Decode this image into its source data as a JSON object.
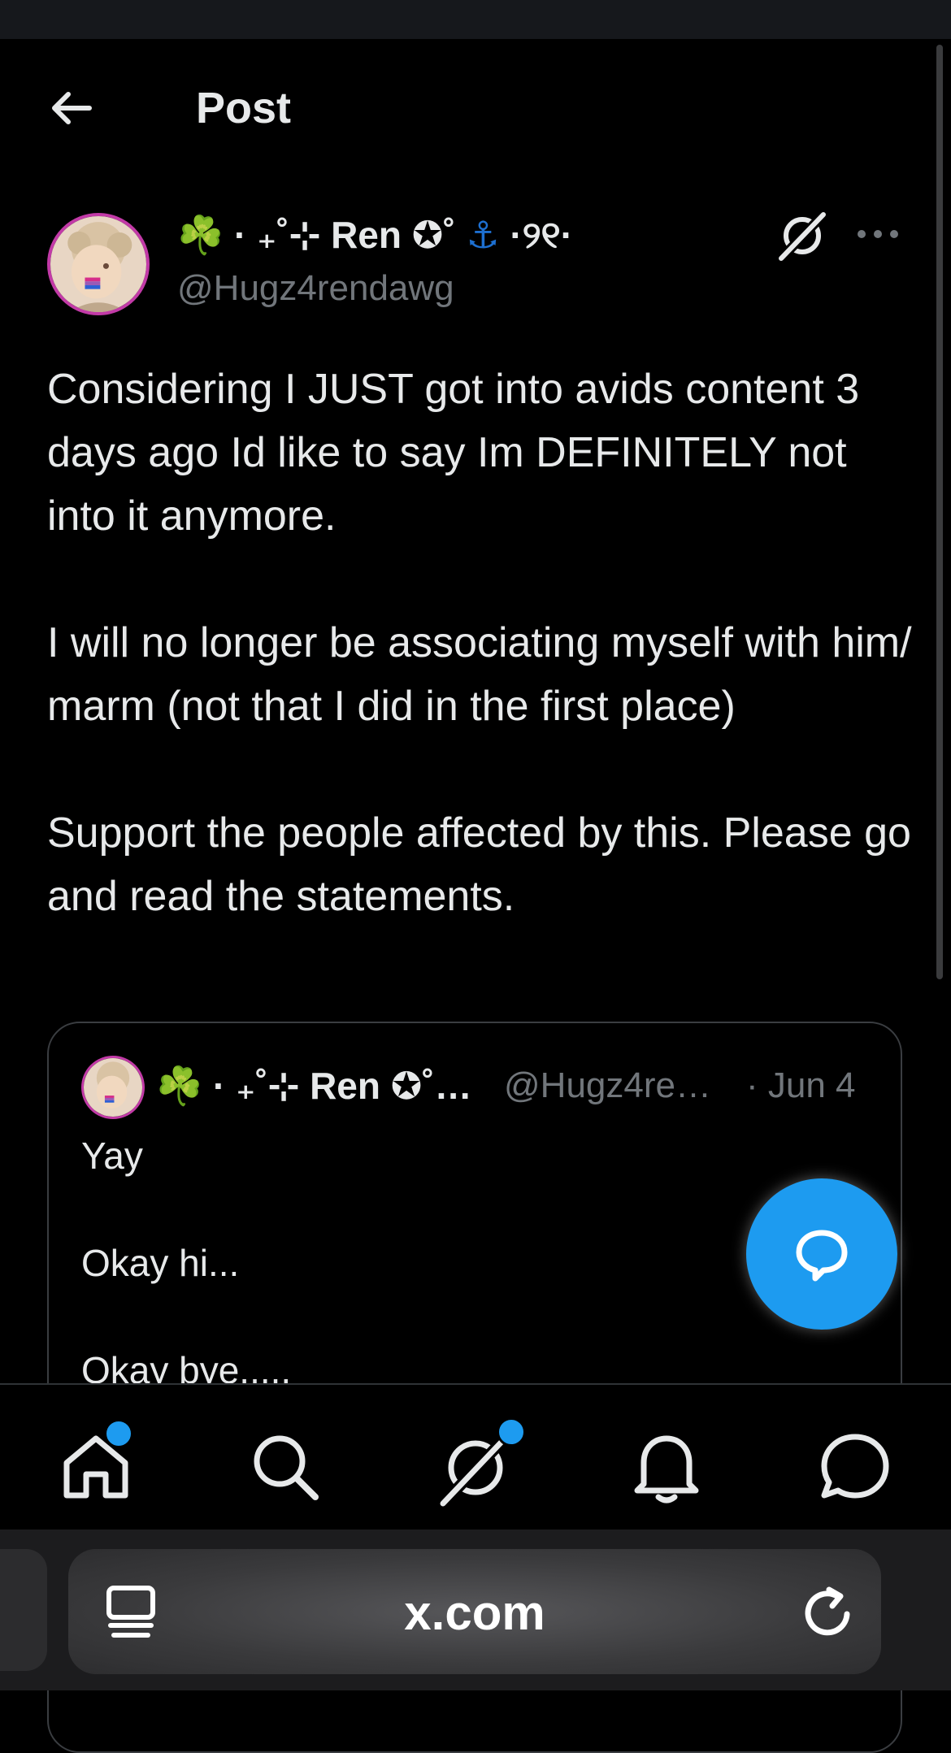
{
  "header": {
    "title": "Post",
    "back_icon": "arrow-left-icon"
  },
  "post": {
    "author_name_prefix": "☘️ ·  ₊˚⊹ Ren ✪˚ ",
    "author_name_suffix": " ·୨୧·",
    "handle": "@Hugz4rendawg",
    "text": "Considering I JUST got into avids content 3 days ago Id like to say Im DEFINITELY not into it anymore.\n\nI will no longer be associating myself with him/ marm (not that I did in the first place)\n\nSupport the people affected by this. Please go and read the statements."
  },
  "quoted_post": {
    "author_name": "☘️ · ₊˚⊹ Ren ✪˚…",
    "handle": "@Hugz4re…",
    "date": "· Jun 4",
    "text": "Yay\n\nOkay hi...\n\nOkay bye....."
  },
  "fab": {
    "icon": "reply-bubble-icon"
  },
  "nav": {
    "items": [
      {
        "icon": "home-icon",
        "badge": true
      },
      {
        "icon": "search-icon",
        "badge": false
      },
      {
        "icon": "grok-icon",
        "badge": true
      },
      {
        "icon": "bell-icon",
        "badge": false
      },
      {
        "icon": "messages-icon",
        "badge": false
      }
    ]
  },
  "browser": {
    "url": "x.com"
  },
  "colors": {
    "accent": "#1d9bf0",
    "background": "#000000",
    "secondary_text": "#71767b"
  }
}
